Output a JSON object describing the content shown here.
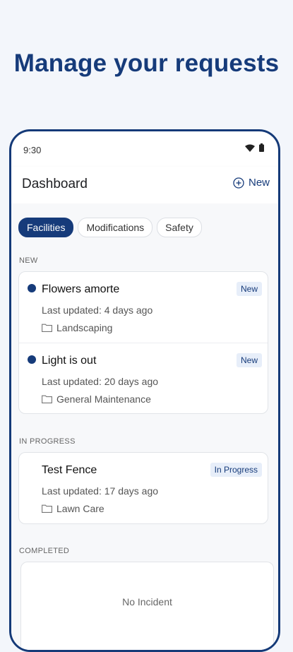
{
  "headline": "Manage your requests",
  "status_bar": {
    "time": "9:30"
  },
  "app_bar": {
    "title": "Dashboard",
    "new_label": "New"
  },
  "filters": [
    "Facilities",
    "Modifications",
    "Safety"
  ],
  "selected_filter": "Facilities",
  "sections": {
    "new": {
      "label": "NEW",
      "items": [
        {
          "title": "Flowers amorte",
          "updated": "Last updated: 4 days ago",
          "category": "Landscaping",
          "badge": "New"
        },
        {
          "title": "Light is out",
          "updated": "Last updated: 20 days ago",
          "category": "General Maintenance",
          "badge": "New"
        }
      ]
    },
    "in_progress": {
      "label": "IN PROGRESS",
      "items": [
        {
          "title": "Test Fence",
          "updated": "Last updated: 17 days ago",
          "category": "Lawn Care",
          "badge": "In Progress"
        }
      ]
    },
    "completed": {
      "label": "COMPLETED",
      "empty_text": "No Incident"
    }
  },
  "colors": {
    "brand": "#163b7a",
    "badge_bg": "#e7eef9",
    "background": "#f3f6fb"
  }
}
